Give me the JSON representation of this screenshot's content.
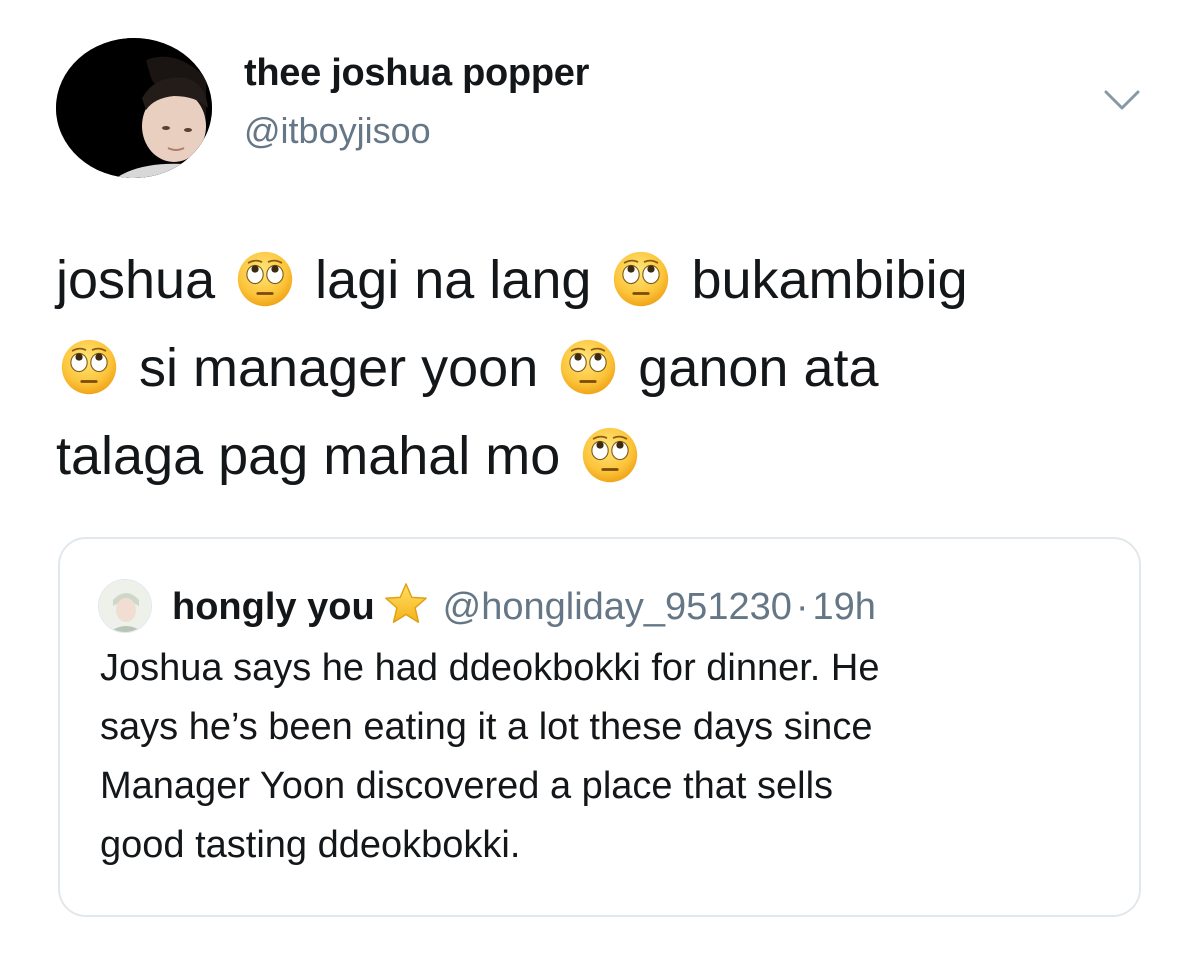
{
  "author": {
    "display_name": "thee joshua popper",
    "handle": "@itboyjisoo",
    "avatar_icon": "profile-photo"
  },
  "menu_icon": "chevron-down-icon",
  "tweet": {
    "lines": [
      [
        "joshua",
        "lagi na lang",
        "bukambibig"
      ],
      [
        "si manager yoon",
        "ganon ata"
      ],
      [
        "talaga pag mahal mo"
      ]
    ],
    "emoji": "face-with-rolling-eyes"
  },
  "quoted_tweet": {
    "display_name": "hongly you",
    "name_emoji": "star",
    "handle": "@hongliday_951230",
    "separator": "·",
    "time": "19h",
    "lines": [
      "Joshua says he had ddeokbokki for dinner. He",
      "says he’s been eating it a lot these days since",
      "Manager Yoon discovered a place that sells",
      "good tasting ddeokbokki."
    ]
  },
  "colors": {
    "text": "#14171a",
    "secondary": "#657786",
    "border": "#e1e8ed",
    "background": "#ffffff"
  }
}
